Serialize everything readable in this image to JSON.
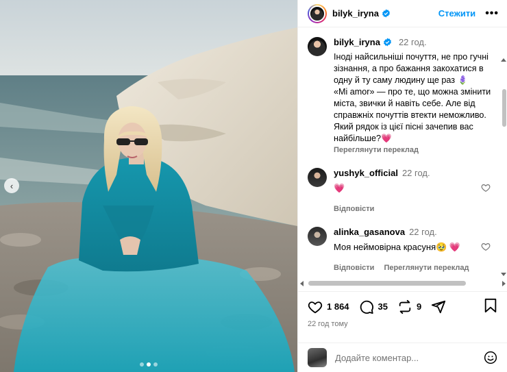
{
  "post": {
    "author": "bilyk_iryna",
    "follow_label": "Стежити",
    "more_label": "•••",
    "caption_time": "22 год.",
    "caption_text": "Іноді найсильніші почуття, не про гучні зізнання, а про бажання закохатися в одну й ту саму людину ще раз 🪻\n«Mi amor» — про те, що можна змінити міста, звички й навіть себе. Але від справжніх почуттів втекти неможливо.\nЯкий рядок із цієї пісні зачепив вас найбільше?💗",
    "see_translation": "Переглянути переклад",
    "likes": "1 864",
    "comments_count": "35",
    "reposts": "9",
    "posted_ago": "22 год тому"
  },
  "comments": [
    {
      "username": "yushyk_official",
      "time": "22 год.",
      "text": "💗",
      "reply_label": "Відповісти",
      "see_translation": ""
    },
    {
      "username": "alinka_gasanova",
      "time": "22 год.",
      "text": "Моя неймовірна красуня🥹 💗",
      "reply_label": "Відповісти",
      "see_translation": "Переглянути переклад"
    }
  ],
  "add_comment": {
    "placeholder": "Додайте коментар..."
  },
  "carousel": {
    "prev_label": "‹",
    "slide_count": 3,
    "active_slide": 2
  },
  "colors": {
    "accent": "#0095f6",
    "secondary_text": "#737373",
    "dress": "#1aa3b8"
  },
  "icons": [
    "verified-icon",
    "heart-icon",
    "comment-icon",
    "repost-icon",
    "share-icon",
    "bookmark-icon",
    "emoji-icon"
  ]
}
